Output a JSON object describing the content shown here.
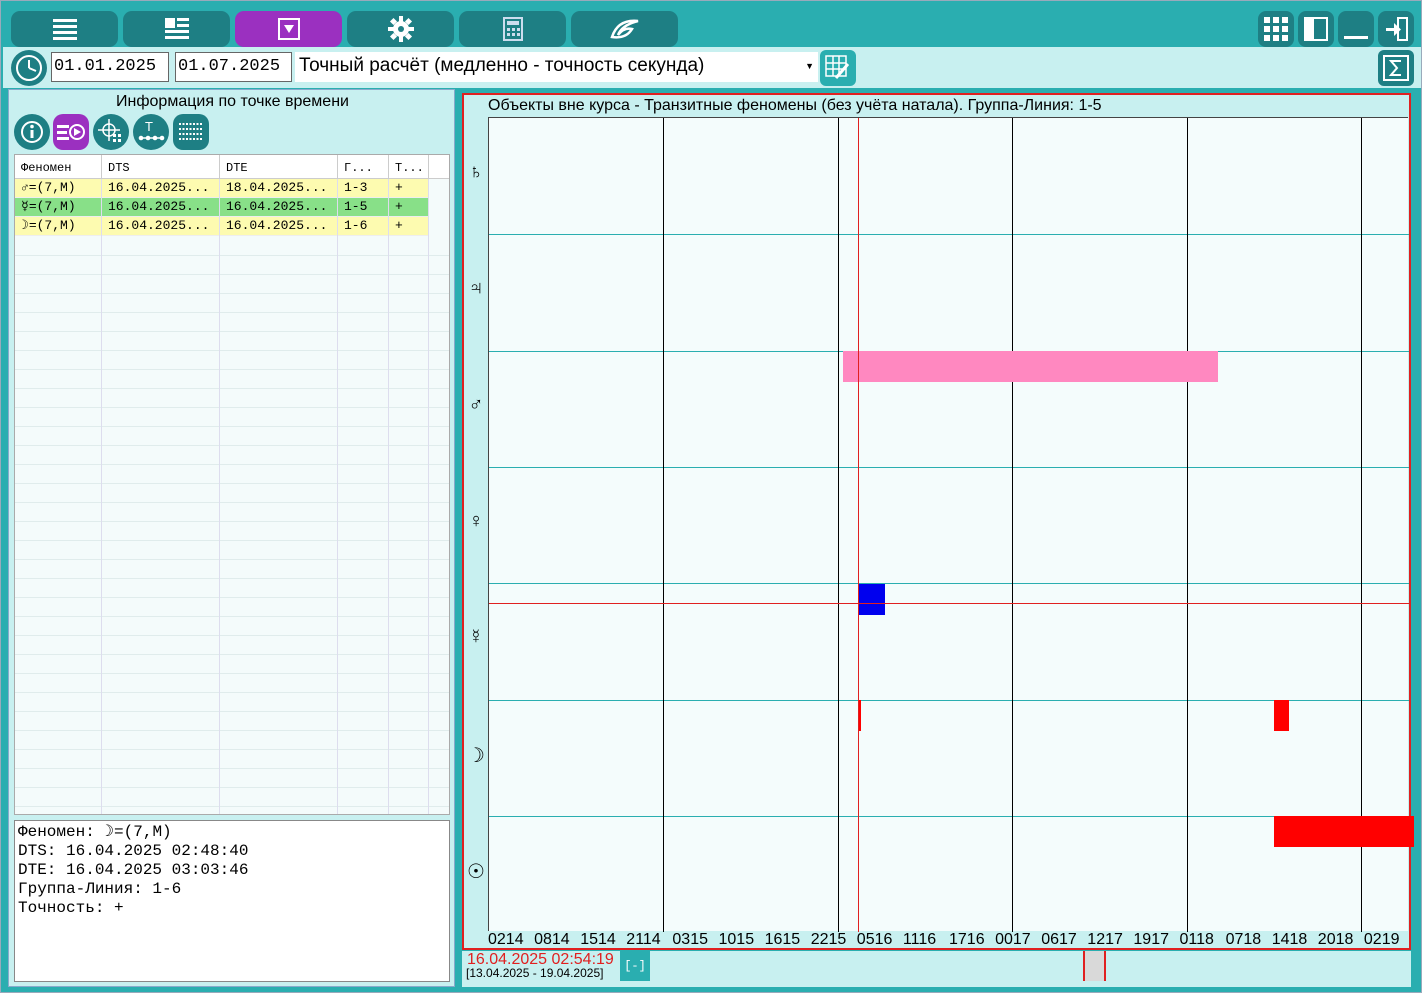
{
  "toolbar": {
    "buttons": [
      "menu-icon",
      "layout-icon",
      "filter-icon",
      "gear-icon",
      "calculator-icon",
      "logo-icon"
    ],
    "right_buttons": [
      "grid-icon",
      "panel-icon",
      "minimize-icon",
      "exit-icon"
    ]
  },
  "dates": {
    "start": "01.01.2025",
    "end": "01.07.2025",
    "mode": "Точный расчёт (медленно - точность секунда)"
  },
  "left": {
    "title": "Информация по точке времени",
    "columns": [
      "Феномен",
      "DTS",
      "DTE",
      "Г...",
      "Т..."
    ],
    "rows": [
      {
        "phen": "♂=(7,M)",
        "dts": "16.04.2025...",
        "dte": "18.04.2025...",
        "group": "1-3",
        "acc": "+",
        "bg": "#fdfbb0"
      },
      {
        "phen": "☿=(7,M)",
        "dts": "16.04.2025...",
        "dte": "16.04.2025...",
        "group": "1-5",
        "acc": "+",
        "bg": "#88e088"
      },
      {
        "phen": "☽=(7,M)",
        "dts": "16.04.2025...",
        "dte": "16.04.2025...",
        "group": "1-6",
        "acc": "+",
        "bg": "#fdfbb0"
      }
    ],
    "info": {
      "l1": "Феномен: ☽=(7,M)",
      "l2": "DTS: 16.04.2025 02:48:40",
      "l3": "DTE: 16.04.2025 03:03:46",
      "l4": "Группа-Линия: 1-6",
      "l5": "Точность: +"
    }
  },
  "chart": {
    "title": "Объекты вне курса - Транзитные феномены (без учёта натала). Группа-Линия: 1-5",
    "y_labels": [
      "♄",
      "♃",
      "♂",
      "♀",
      "☿",
      "☽",
      "☉"
    ],
    "x_labels": [
      "0214",
      "0814",
      "1514",
      "2114",
      "0315",
      "1015",
      "1615",
      "2215",
      "0516",
      "1116",
      "1716",
      "0017",
      "0617",
      "1217",
      "1917",
      "0118",
      "0718",
      "1418",
      "2018",
      "0219"
    ],
    "cursor_time": "16.04.2025 02:54:19",
    "range": "[13.04.2025 - 19.04.2025]",
    "zoom_btn": "[-]"
  },
  "colors": {
    "accent": "#2aaeb0",
    "active": "#9b30c0",
    "pink": "#ff88c0",
    "blue": "#0000ee",
    "red": "#ff0000"
  }
}
